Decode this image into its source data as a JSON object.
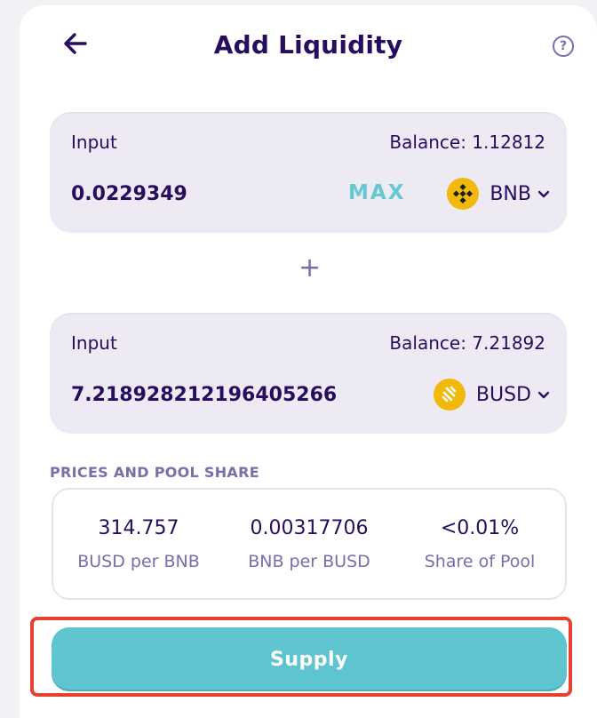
{
  "header": {
    "title": "Add Liquidity",
    "back_icon": "arrow-left-icon",
    "help_icon": "question-circle-icon",
    "help_glyph": "?"
  },
  "input_a": {
    "label": "Input",
    "balance": "Balance: 1.12812",
    "amount": "0.0229349",
    "max_label": "MAX",
    "token": "BNB",
    "token_icon": "bnb-icon"
  },
  "plus_symbol": "+",
  "input_b": {
    "label": "Input",
    "balance": "Balance: 7.21892",
    "amount": "7.218928212196405266",
    "token": "BUSD",
    "token_icon": "busd-icon"
  },
  "prices": {
    "section_label": "PRICES AND POOL SHARE",
    "items": [
      {
        "value": "314.757",
        "label": "BUSD per BNB"
      },
      {
        "value": "0.00317706",
        "label": "BNB per BUSD"
      },
      {
        "value": "<0.01%",
        "label": "Share of Pool"
      }
    ]
  },
  "supply": {
    "label": "Supply",
    "highlight_color": "#e8402e"
  },
  "colors": {
    "text_primary": "#280d5f",
    "text_secondary": "#7a6eaa",
    "accent": "#5ec4cf",
    "input_bg": "#eeeaf4",
    "token_gold": "#f0b90b"
  }
}
